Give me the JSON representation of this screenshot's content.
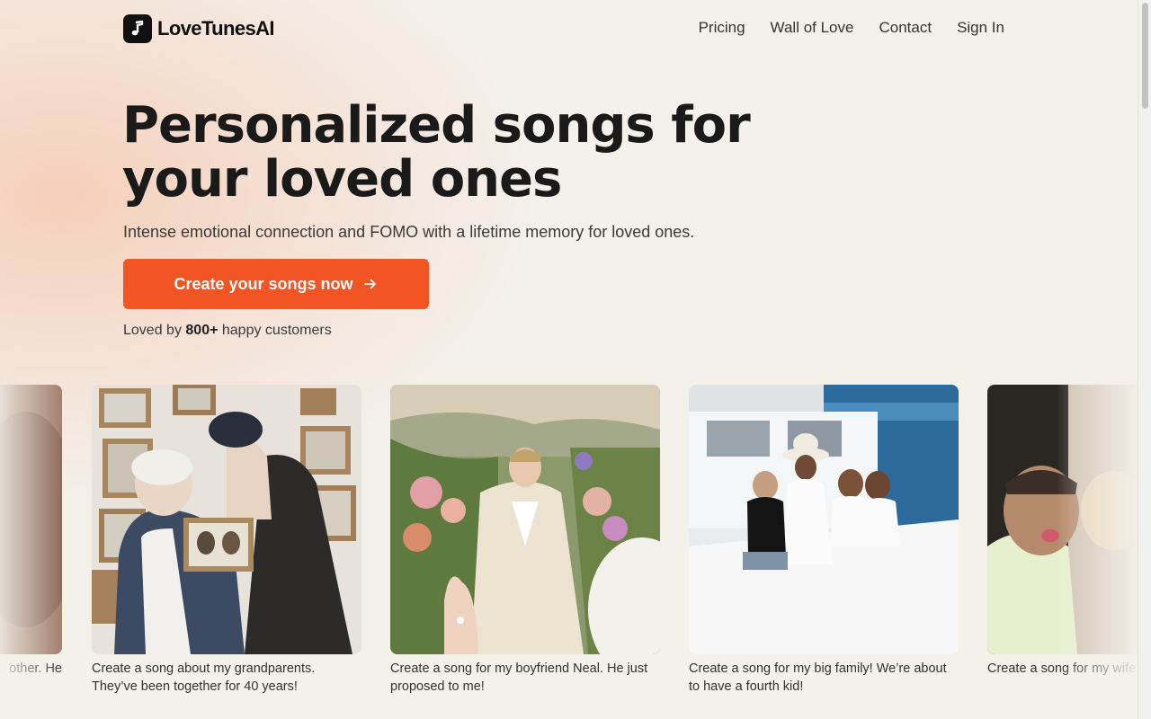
{
  "brand": {
    "name": "LoveTunesAI"
  },
  "nav": {
    "items": [
      {
        "label": "Pricing"
      },
      {
        "label": "Wall of Love"
      },
      {
        "label": "Contact"
      },
      {
        "label": "Sign In"
      }
    ]
  },
  "hero": {
    "title_line1": "Personalized songs for",
    "title_line2": "your loved ones",
    "subtitle": "Intense emotional connection and FOMO with a lifetime memory for loved ones.",
    "cta_label": "Create your songs now",
    "social_prefix": "Loved by ",
    "social_count": "800+",
    "social_suffix": " happy customers"
  },
  "cards": [
    {
      "caption": "other. He"
    },
    {
      "caption": "Create a song about my grandparents. They’ve been together for 40 years!"
    },
    {
      "caption": "Create a song for my boyfriend Neal. He just proposed to me!"
    },
    {
      "caption": "Create a song for my big family! We’re about to have a fourth kid!"
    },
    {
      "caption": "Create a song for my wife my everything!"
    }
  ],
  "colors": {
    "accent": "#f25423",
    "background": "#f4f0ea"
  }
}
